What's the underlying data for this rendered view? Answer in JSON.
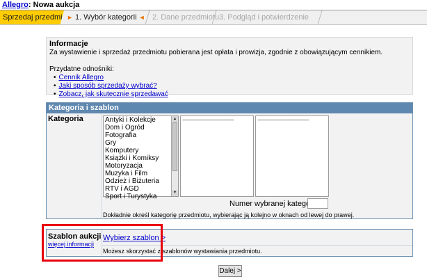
{
  "header": {
    "brand": "Allegro",
    "separator": ":",
    "title": "Nowa aukcja"
  },
  "steps": {
    "sell": "Sprzedaj przedmiot",
    "active_arrow_left": "►",
    "active": "1. Wybór kategorii",
    "active_arrow_right": "◄",
    "step2": "2. Dane przedmiotu",
    "step3": "3. Podgląd i potwierdzenie"
  },
  "info": {
    "heading": "Informacje",
    "text": "Za wystawienie i sprzedaż przedmiotu pobierana jest opłata i prowizja, zgodnie z obowiązującym cennikiem.",
    "links_label": "Przydatne odnośniki:",
    "links": [
      "Cennik Allegro",
      "Jaki sposób sprzedaży wybrać?",
      "Zobacz, jak skutecznie sprzedawać"
    ]
  },
  "category": {
    "header": "Kategoria i szablon",
    "label": "Kategoria",
    "items": [
      "Antyki i Kolekcje",
      "Dom i Ogród",
      "Fotografia",
      "Gry",
      "Komputery",
      "Książki i Komiksy",
      "Motoryzacja",
      "Muzyka i Film",
      "Odzież i Biżuteria",
      "RTV i AGD",
      "Sport i Turystyka"
    ],
    "placeholder_line": "-------------------------------------",
    "number_label": "Numer wybranej kategorii",
    "number_value": "",
    "hint": "Dokładnie określ kategorię przedmiotu, wybierając ją kolejno w oknach od lewej do prawej."
  },
  "template": {
    "label": "Szablon aukcji",
    "more_link": "więcej informacji",
    "choose_link": "Wybierz szablon >",
    "desc": "Możesz skorzystać z szablonów wystawiania przedmiotu."
  },
  "next_button": "Dalej >",
  "colors": {
    "accent_yellow": "#ffcc00",
    "section_header": "#5f88b0",
    "highlight": "#e8000b",
    "link": "#0000cc"
  }
}
